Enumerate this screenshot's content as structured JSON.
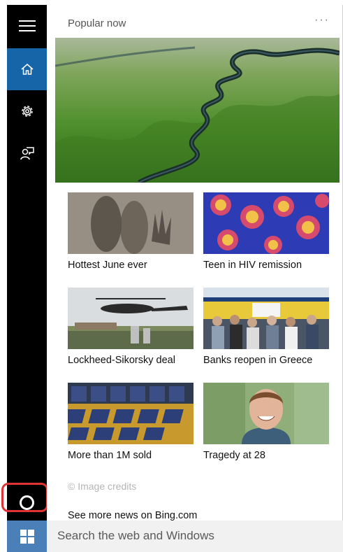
{
  "header": {
    "title": "Popular now",
    "more_label": "···"
  },
  "sidebar": {
    "items": [
      {
        "icon": "hamburger-menu-icon"
      },
      {
        "icon": "home-icon",
        "active": true
      },
      {
        "icon": "gear-icon"
      },
      {
        "icon": "feedback-icon"
      }
    ],
    "cortana_icon": "cortana-ring-icon"
  },
  "tiles": [
    {
      "caption": "Hottest June ever"
    },
    {
      "caption": "Teen in HIV remission"
    },
    {
      "caption": "Lockheed-Sikorsky deal"
    },
    {
      "caption": "Banks reopen in Greece"
    },
    {
      "caption": "More than 1M sold"
    },
    {
      "caption": "Tragedy at 28"
    }
  ],
  "footer": {
    "credits": "© Image credits",
    "see_more": "See more news on Bing.com"
  },
  "taskbar": {
    "search_placeholder": "Search the web and Windows",
    "start_icon": "windows-logo-icon"
  },
  "colors": {
    "active_blue": "#1565a8",
    "sidebar_bg": "#000000",
    "highlight_red": "#e03333",
    "start_blue": "#4a7fb8"
  }
}
